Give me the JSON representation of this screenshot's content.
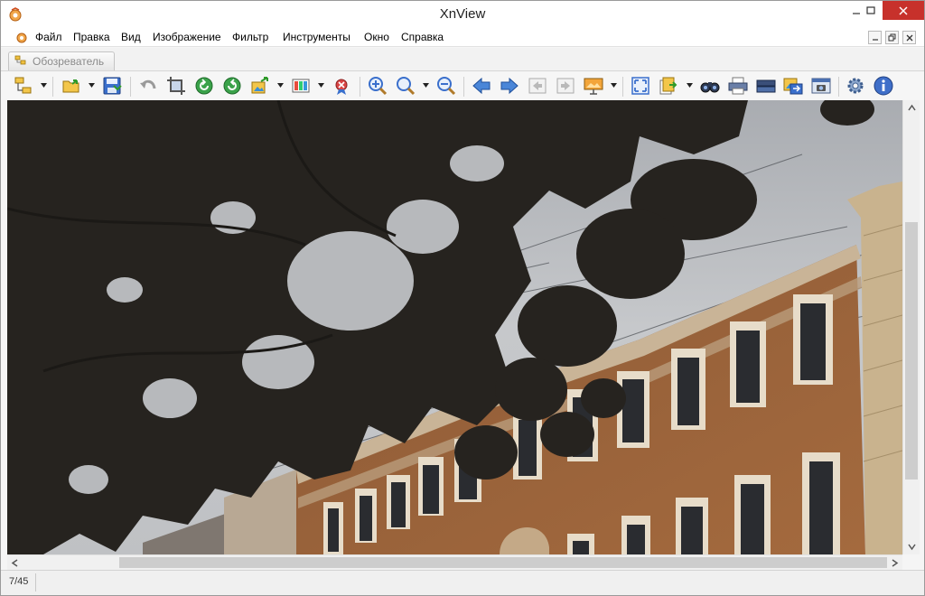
{
  "window": {
    "title": "XnView"
  },
  "menu": {
    "items": [
      "Файл",
      "Правка",
      "Вид",
      "Изображение",
      "Фильтр",
      "Инструменты",
      "Окно",
      "Справка"
    ]
  },
  "tabs": {
    "browser_label": "Обозреватель"
  },
  "toolbar": {
    "icons": [
      "browser-icon",
      "open-folder-icon",
      "save-icon",
      "undo-icon",
      "crop-icon",
      "rotate-left-icon",
      "rotate-right-icon",
      "convert-icon",
      "adjust-icon",
      "filter-icon",
      "zoom-in-icon",
      "zoom-icon",
      "zoom-out-icon",
      "previous-icon",
      "next-icon",
      "first-icon",
      "last-icon",
      "slideshow-icon",
      "fullscreen-icon",
      "copy-to-icon",
      "search-icon",
      "print-icon",
      "scan-icon",
      "export-icon",
      "capture-icon",
      "settings-icon",
      "info-icon"
    ]
  },
  "status": {
    "counter": "7/45"
  },
  "colors": {
    "close_button": "#c7312b",
    "accent_blue": "#3f6fc9",
    "facade": "#a0653a"
  }
}
